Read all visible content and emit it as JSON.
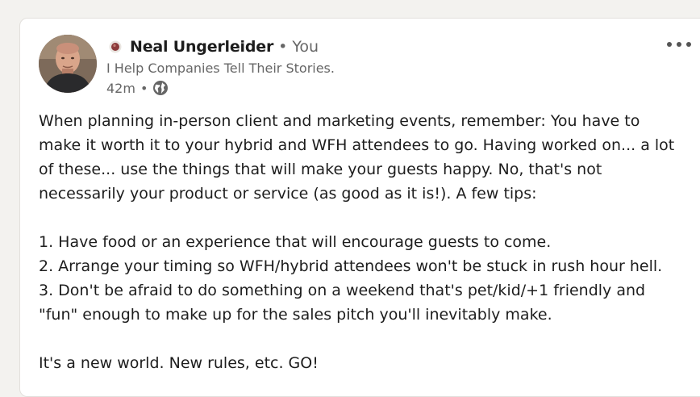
{
  "post": {
    "author": {
      "name": "Neal Ungerleider",
      "connection_separator": "•",
      "connection": "You",
      "headline": "I Help Companies Tell Their Stories.",
      "avatar_icon": "profile-photo"
    },
    "meta": {
      "time": "42m",
      "separator": "•",
      "visibility_icon": "globe-icon"
    },
    "menu_icon": "more-horizontal-icon",
    "body": {
      "lines": [
        "When planning in-person client and marketing events, remember: You have to",
        "make it worth it to your hybrid and WFH attendees to go. Having worked on... a lot",
        "of these... use the things that will make your guests happy. No, that's not",
        "necessarily your product or service (as good as it is!). A few tips:",
        "",
        "1. Have food or an experience that will encourage guests to come.",
        "2. Arrange your timing so WFH/hybrid attendees won't be stuck in rush hour hell.",
        "3. Don't be afraid to do something on a weekend that's pet/kid/+1 friendly and",
        "\"fun\" enough to make up for the sales pitch you'll inevitably make.",
        "",
        "It's a new world. New rules, etc. GO!"
      ]
    }
  },
  "colors": {
    "page_bg": "#f3f2ef",
    "card_bg": "#ffffff",
    "text_primary": "#1d1d1d",
    "text_secondary": "#666666",
    "badge": "#8b3a3a"
  }
}
